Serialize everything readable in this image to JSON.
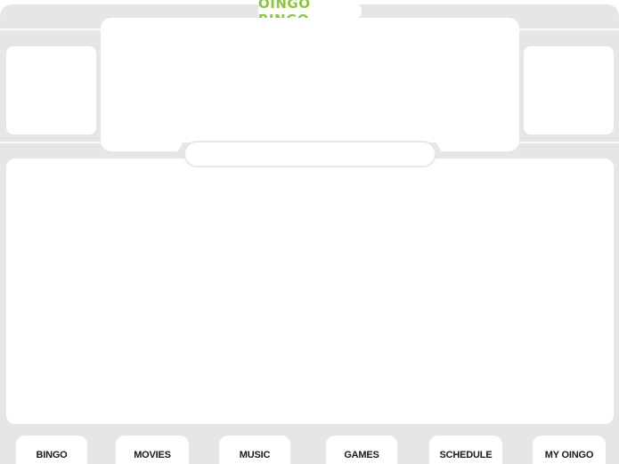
{
  "app": {
    "logo_text": "OINGO BINGO"
  },
  "colors": {
    "frame": "#e6e6e6",
    "frame_edge": "#d9d9d9",
    "logo_green": "#8cc63f",
    "nav_text": "#1a1a1a",
    "panel": "#ffffff"
  },
  "nav": {
    "items": [
      {
        "label": "BINGO"
      },
      {
        "label": "MOVIES"
      },
      {
        "label": "MUSIC"
      },
      {
        "label": "GAMES"
      },
      {
        "label": "SCHEDULE"
      },
      {
        "label": "MY OINGO"
      }
    ]
  }
}
